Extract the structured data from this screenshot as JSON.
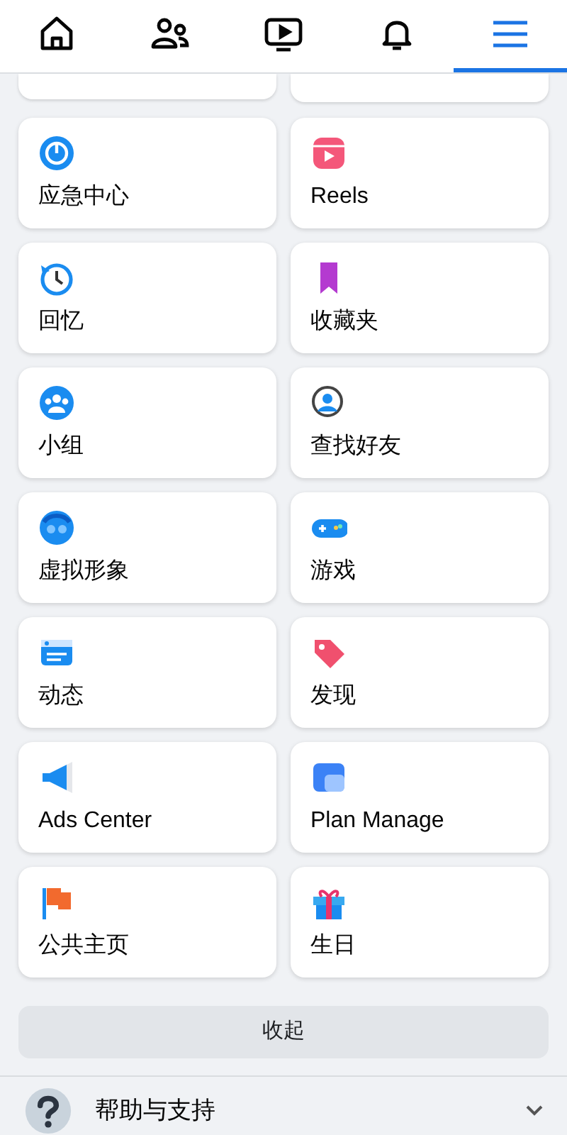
{
  "tabs": [
    {
      "selected": false
    },
    {
      "selected": false
    },
    {
      "selected": false
    },
    {
      "selected": false
    },
    {
      "selected": true
    }
  ],
  "shortcuts": [
    {
      "label": "应急中心"
    },
    {
      "label": "Reels"
    },
    {
      "label": "回忆"
    },
    {
      "label": "收藏夹"
    },
    {
      "label": "小组"
    },
    {
      "label": "查找好友"
    },
    {
      "label": "虚拟形象"
    },
    {
      "label": "游戏"
    },
    {
      "label": "动态"
    },
    {
      "label": "发现"
    },
    {
      "label": "Ads Center"
    },
    {
      "label": "Plan Manage"
    },
    {
      "label": "公共主页"
    },
    {
      "label": "生日"
    }
  ],
  "collapse_button": "收起",
  "help": {
    "label": "帮助与支持",
    "expanded": false
  }
}
